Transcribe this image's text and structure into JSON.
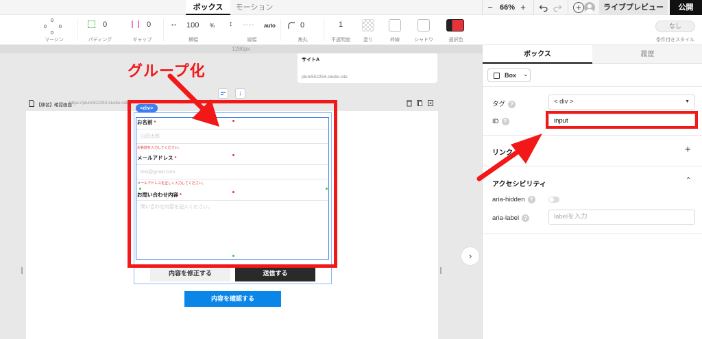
{
  "topbar": {
    "tabs": [
      {
        "label": "ボックス"
      },
      {
        "label": "モーション"
      }
    ],
    "zoom": "66%",
    "zoom_minus": "−",
    "zoom_plus": "+",
    "live_preview": "ライブプレビュー",
    "publish": "公開"
  },
  "toolbar": {
    "margin": {
      "top": "0",
      "left": "0",
      "right": "0",
      "bottom": "0",
      "label": "マージン"
    },
    "padding": {
      "value": "0",
      "label": "パディング"
    },
    "gap": {
      "value": "0",
      "label": "ギャップ"
    },
    "width": {
      "value": "100",
      "unit": "%",
      "label": "横幅"
    },
    "height": {
      "value": "----",
      "unit": "auto",
      "label": "縦幅"
    },
    "radius": {
      "value": "0",
      "label": "角丸"
    },
    "opacity": {
      "value": "1",
      "label": "不透明度"
    },
    "fill": {
      "label": "塗り"
    },
    "border": {
      "label": "枠線"
    },
    "shadow": {
      "label": "シャドウ"
    },
    "selected_color": {
      "label": "選択色",
      "color": "#e8333a"
    },
    "conditional": {
      "value": "なし",
      "label": "条件付きスタイル"
    }
  },
  "canvas": {
    "width_label": "1280px",
    "site": {
      "name": "サイトA",
      "url": "plum502254.studio.site"
    },
    "page_title": "【練習】確認画面",
    "page_url": "https://plum502254.studio.site",
    "element_tag": "<div>",
    "annotation": "グループ化",
    "form": {
      "name": {
        "label": "お名前",
        "req": "*",
        "placeholder": "山田太郎",
        "error": "お名前を入力してください。"
      },
      "email": {
        "label": "メールアドレス",
        "req": "*",
        "placeholder": "test@gmail.com",
        "error": "メールアドレスを正しく入力してください。"
      },
      "message": {
        "label": "お問い合わせ内容",
        "req": "*",
        "placeholder": "問い合わせ内容を記入ください。"
      }
    },
    "buttons": {
      "edit": "内容を修正する",
      "send": "送信する",
      "confirm": "内容を確認する"
    }
  },
  "panel": {
    "tabs": [
      {
        "label": "ボックス"
      },
      {
        "label": "履歴"
      }
    ],
    "box_selector": "Box",
    "tag": {
      "label": "タグ",
      "value": "< div >"
    },
    "id": {
      "label": "ID",
      "value": "input"
    },
    "link": {
      "label": "リンク",
      "add": "+"
    },
    "accessibility": {
      "title": "アクセシビリティ",
      "aria_hidden": {
        "label": "aria-hidden"
      },
      "aria_label": {
        "label": "aria-label",
        "placeholder": "labelを入力"
      }
    }
  },
  "colors": {
    "accent_red": "#f21818",
    "confirm_blue": "#0a86e8",
    "send_dark": "#2a2a2a",
    "selection_blue": "#3d7ef0"
  }
}
